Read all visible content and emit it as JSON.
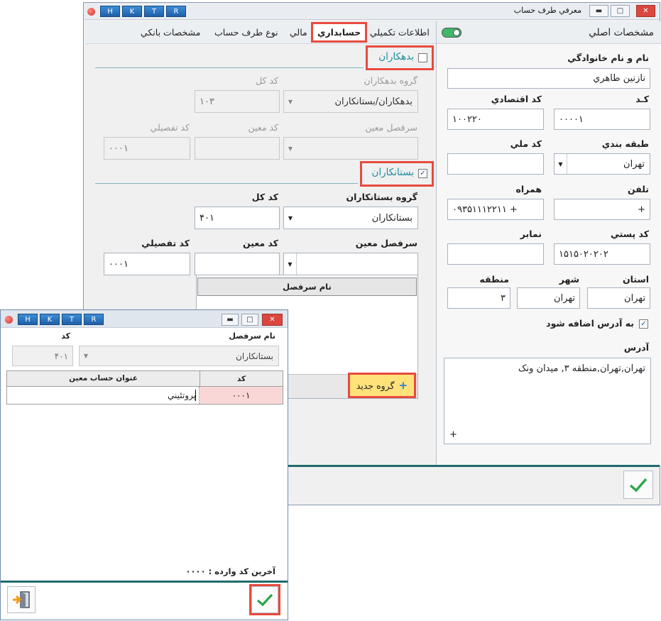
{
  "main_window": {
    "title": "معرفي طرف حساب",
    "hktr": [
      "H",
      "K",
      "T",
      "R"
    ],
    "tabs": [
      "مشخصات بانكي",
      "نوع طرف حساب",
      "مالي",
      "حسابداري",
      "اطلاعات تكميلي"
    ],
    "active_tab_index": 3,
    "right_panel": {
      "title": "مشخصات اصلي",
      "name_label": "نام و نام خانوادگي",
      "name_value": "نازنين طاهري",
      "code_label": "كـد",
      "code_value": "۰۰۰۰۱",
      "econ_code_label": "كد اقتصادي",
      "econ_code_value": "۱۰۰۲۲۰",
      "category_label": "طبقه بندي",
      "category_value": "تهران",
      "national_code_label": "كد ملي",
      "national_code_value": "",
      "phone_label": "تلفن",
      "phone_value": "+",
      "mobile_label": "همراه",
      "mobile_value": "۰۹۳۵۱۱۱۲۲۱۱   +",
      "postal_code_label": "كد پستي",
      "postal_code_value": "۱۵۱۵۰۲۰۲۰۲",
      "fax_label": "نمابر",
      "fax_value": "",
      "province_label": "استان",
      "province_value": "تهران",
      "city_label": "شهر",
      "city_value": "تهران",
      "region_label": "منطقه",
      "region_value": "۳",
      "add_to_address_label": "به آدرس اضافه شود",
      "address_label": "آدرس",
      "address_value": "تهران,تهران,منطقه ۳, ميدان ونک",
      "address_plus": "+"
    },
    "accounting": {
      "debtors_label": "بدهكاران",
      "debtors_group_label": "گروه بدهكاران",
      "debtors_group_value": "بدهكاران/بستانكاران",
      "debtors_total_code_label": "كد كل",
      "debtors_total_code_value": "۱۰۳",
      "debtors_heading_label": "سرفصل معين",
      "debtors_moein_label": "كد معين",
      "debtors_detail_label": "كد تفصيلي",
      "debtors_detail_value": "۰۰۰۱",
      "creditors_label": "بستانكاران",
      "creditors_group_label": "گروه بستانكاران",
      "creditors_group_value": "بستانكاران",
      "creditors_total_code_label": "كد كل",
      "creditors_total_code_value": "۴۰۱",
      "creditors_heading_label": "سرفصل معين",
      "creditors_moein_label": "كد معين",
      "creditors_detail_label": "كد تفصيلي",
      "creditors_detail_value": "۰۰۰۱",
      "heading_name_column": "نام سرفصل",
      "new_group_label": "گروه جديد",
      "new_group_icon": "+"
    }
  },
  "dialog": {
    "hktr": [
      "H",
      "K",
      "T",
      "R"
    ],
    "heading_name_label": "نام سرفصل",
    "heading_name_value": "بستانكاران",
    "code_label": "كد",
    "code_value": "۴۰۱",
    "table": {
      "columns": [
        "كد",
        "عنوان حساب معين"
      ],
      "rows": [
        {
          "code": "۰۰۰۱",
          "title": "پروتئيني"
        }
      ]
    },
    "last_code_text": "آخرين كد وارده : ۰۰۰۰"
  },
  "colors": {
    "accent_teal": "#1c8c9c",
    "highlight_red": "#e84a3f",
    "ok_green": "#2aa84a"
  }
}
